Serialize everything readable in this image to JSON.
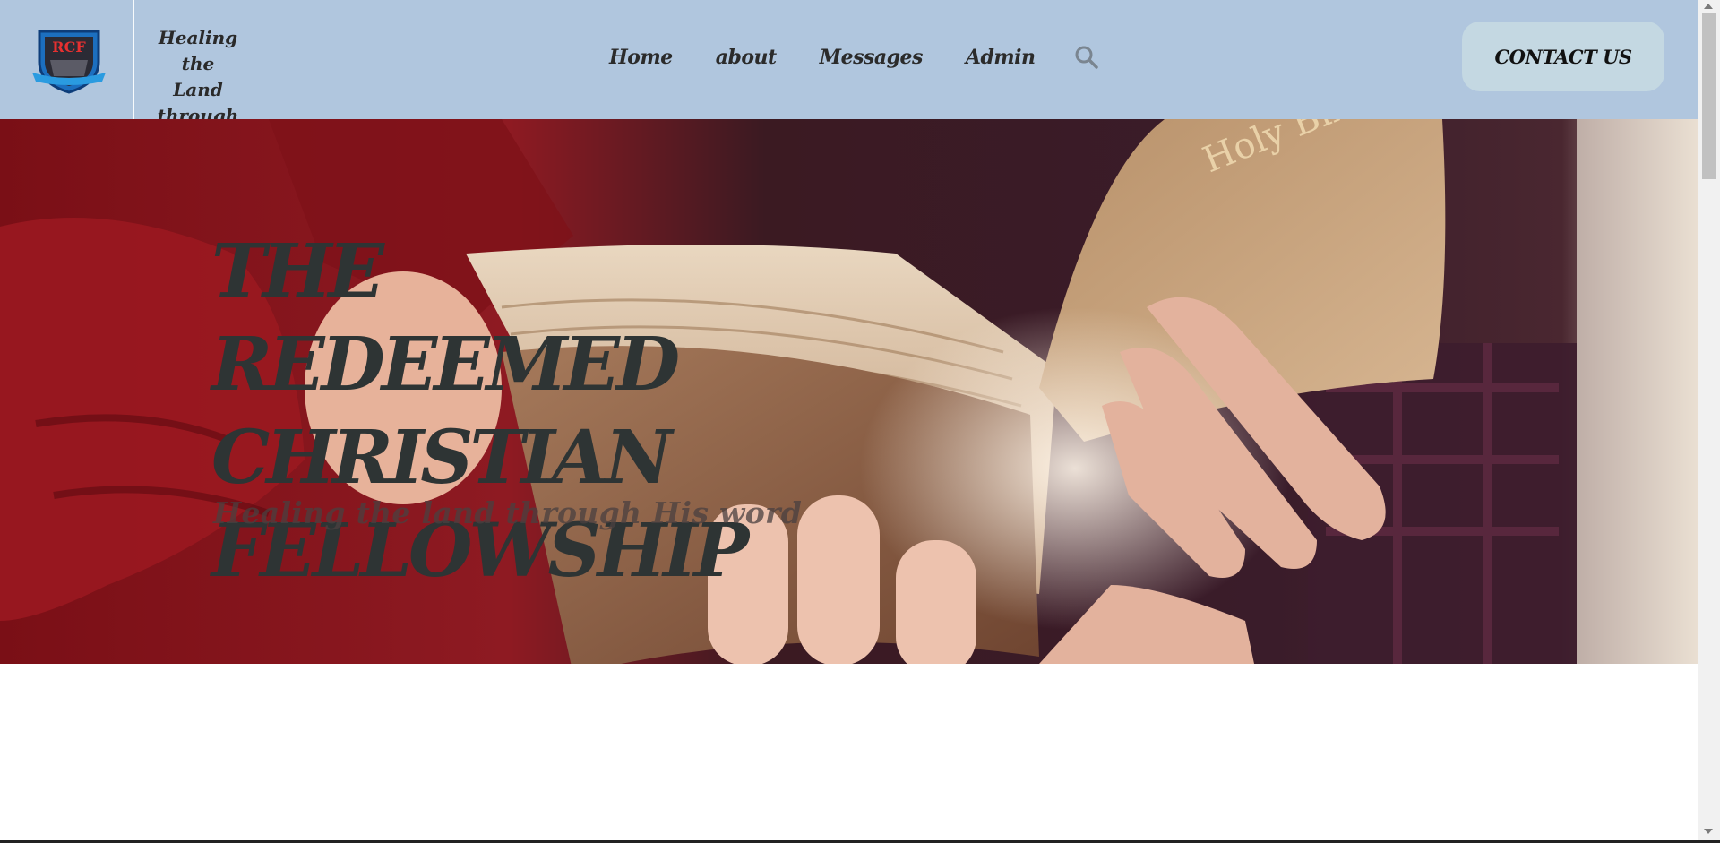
{
  "header": {
    "tagline": "Healing the\nLand through\nHis Word",
    "logo": {
      "icon": "church-shield-logo-icon",
      "letters": "RCF"
    },
    "nav": [
      {
        "label": "Home"
      },
      {
        "label": "about"
      },
      {
        "label": "Messages"
      },
      {
        "label": "Admin"
      }
    ],
    "search_icon": "search-icon",
    "contact_label": "CONTACT US",
    "background_color": "#b0c6de",
    "contact_bg": "#c4d8e2"
  },
  "hero": {
    "title": "THE REDEEMED CHRISTIAN FELLOWSHIP",
    "subtitle": "Healing the land through His word",
    "book_spine_text": "Holy Bible",
    "title_color": "#2e3434",
    "image_description_icon": "hands-holding-bible-image"
  }
}
